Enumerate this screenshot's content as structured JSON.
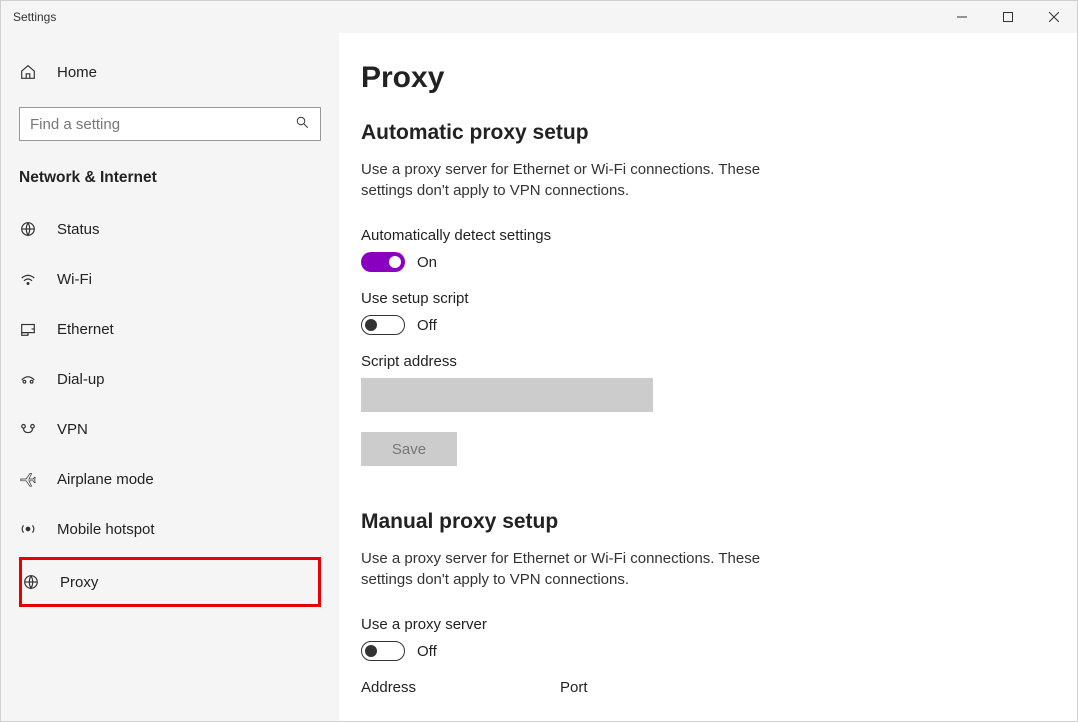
{
  "window": {
    "title": "Settings"
  },
  "sidebar": {
    "home": "Home",
    "search_placeholder": "Find a setting",
    "section": "Network & Internet",
    "items": [
      {
        "label": "Status"
      },
      {
        "label": "Wi-Fi"
      },
      {
        "label": "Ethernet"
      },
      {
        "label": "Dial-up"
      },
      {
        "label": "VPN"
      },
      {
        "label": "Airplane mode"
      },
      {
        "label": "Mobile hotspot"
      },
      {
        "label": "Proxy"
      }
    ]
  },
  "main": {
    "title": "Proxy",
    "auto": {
      "heading": "Automatic proxy setup",
      "desc": "Use a proxy server for Ethernet or Wi-Fi connections. These settings don't apply to VPN connections.",
      "detect_label": "Automatically detect settings",
      "detect_state": "On",
      "script_label": "Use setup script",
      "script_state": "Off",
      "script_addr_label": "Script address",
      "save": "Save"
    },
    "manual": {
      "heading": "Manual proxy setup",
      "desc": "Use a proxy server for Ethernet or Wi-Fi connections. These settings don't apply to VPN connections.",
      "use_label": "Use a proxy server",
      "use_state": "Off",
      "address_label": "Address",
      "port_label": "Port"
    }
  }
}
